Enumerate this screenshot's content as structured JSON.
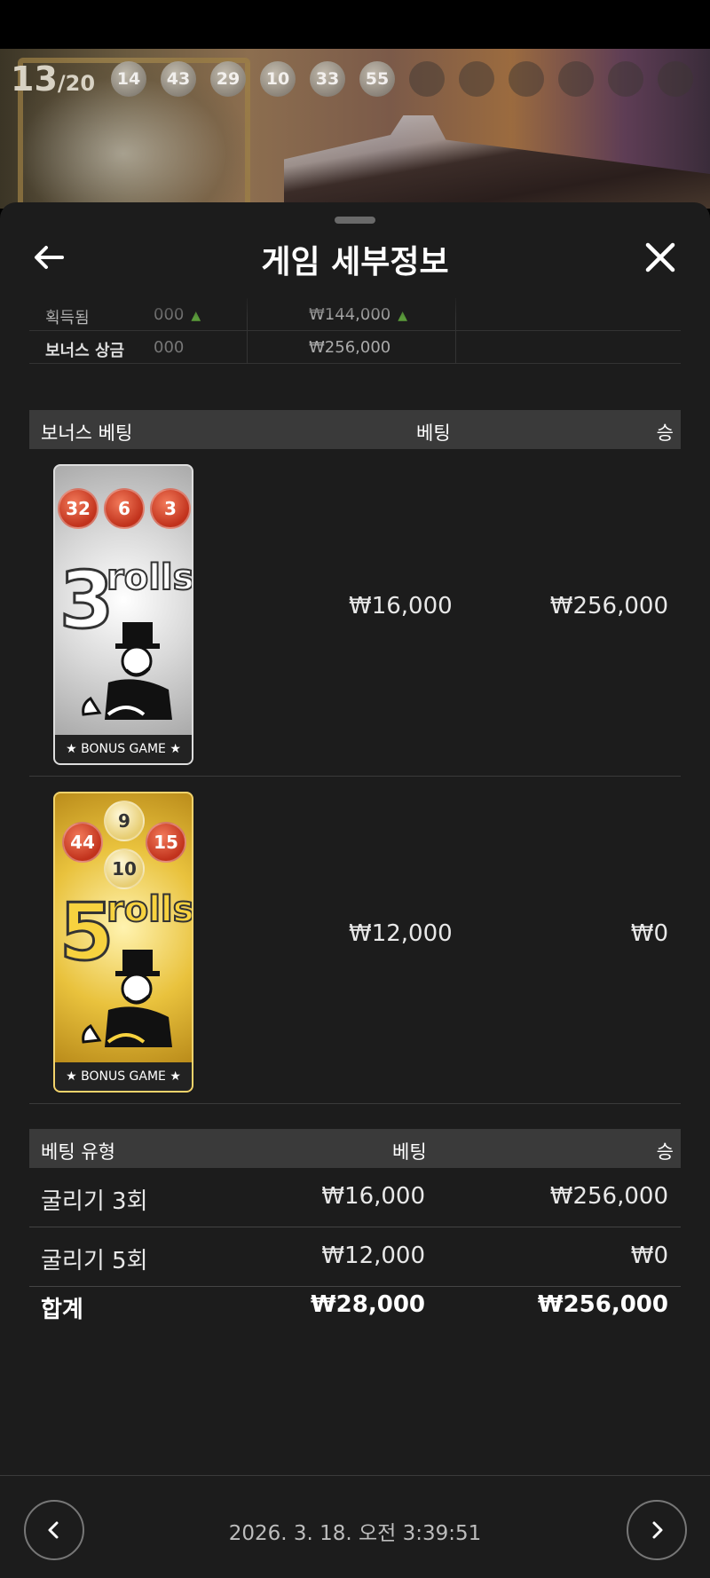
{
  "game_strip": {
    "round_current": "13",
    "round_total": "/20",
    "balls": [
      "14",
      "43",
      "29",
      "10",
      "33",
      "55"
    ]
  },
  "header": {
    "title": "게임 세부정보",
    "back_icon": "arrow-left-icon",
    "close_icon": "close-icon"
  },
  "previous_table": {
    "rows": [
      {
        "label": "획득됨",
        "partial": "000",
        "value": "₩144,000"
      },
      {
        "label": "보너스 상금",
        "partial": "000",
        "value": "₩256,000"
      }
    ]
  },
  "bonus_table": {
    "headers": {
      "type": "보너스 베팅",
      "bet": "베팅",
      "win": "승"
    },
    "rows": [
      {
        "card": {
          "balls": [
            "32",
            "6",
            "3"
          ],
          "rolls_count": "3",
          "rolls_word": "rolls",
          "band": "★ BONUS GAME ★",
          "style": "silver"
        },
        "bet": "₩16,000",
        "win": "₩256,000"
      },
      {
        "card": {
          "balls": [
            "9",
            "44",
            "15",
            "10"
          ],
          "rolls_count": "5",
          "rolls_word": "rolls",
          "band": "★ BONUS GAME ★",
          "style": "gold"
        },
        "bet": "₩12,000",
        "win": "₩0"
      }
    ]
  },
  "bet_type_table": {
    "headers": {
      "type": "베팅 유형",
      "bet": "베팅",
      "win": "승"
    },
    "rows": [
      {
        "type": "굴리기 3회",
        "bet": "₩16,000",
        "win": "₩256,000"
      },
      {
        "type": "굴리기 5회",
        "bet": "₩12,000",
        "win": "₩0"
      }
    ],
    "total": {
      "label": "합계",
      "bet": "₩28,000",
      "win": "₩256,000"
    }
  },
  "footer": {
    "timestamp": "2026. 3. 18. 오전 3:39:51",
    "prev_icon": "chevron-left-icon",
    "next_icon": "chevron-right-icon"
  },
  "colors": {
    "sheet_bg": "#1c1c1c",
    "header_row_bg": "#3a3a3a",
    "ball_red": "#c1321c",
    "card_gold": "#e9c23d"
  }
}
